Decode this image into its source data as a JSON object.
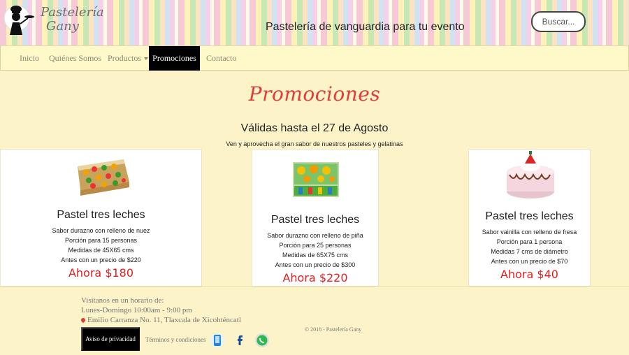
{
  "header": {
    "logo_line1": "Pastelería",
    "logo_line2": "Gany",
    "tagline": "Pastelería de vanguardia para tu evento",
    "search_label": "Buscar..."
  },
  "nav": {
    "items": [
      {
        "label": "Inicio"
      },
      {
        "label": "Quiénes Somos"
      },
      {
        "label": "Productos"
      },
      {
        "label": "Promociones"
      },
      {
        "label": "Contacto"
      }
    ],
    "active": "Promociones"
  },
  "main": {
    "title": "Promociones",
    "subtitle": "Válidas hasta el 27 de Agosto",
    "note": "Ven y aprovecha el gran sabor de nuestros pasteles y gelatinas"
  },
  "cards": [
    {
      "title": "Pastel tres leches",
      "lines": [
        "Sabor durazno con relleno de nuez",
        "Porción para 15 personas",
        "Medidas de 45X65 cms",
        "Antes con un precio de $220"
      ],
      "price": "Ahora $180"
    },
    {
      "title": "Pastel tres leches",
      "lines": [
        "Sabor durazno con relleno de piña",
        "Porción para 25 personas",
        "Medidas de 65X75 cms",
        "Antes con un precio de $300"
      ],
      "price": "Ahora $220"
    },
    {
      "title": "Pastel tres leches",
      "lines": [
        "Sabor vainilla con relleno de fresa",
        "Porción para 1 persona",
        "Medidas 7 cms de diámetro",
        "Antes con un precio de $70"
      ],
      "price": "Ahora $40"
    }
  ],
  "footer": {
    "hours_title": "Visitanos en un horario de:",
    "hours": "Lunes-Domingo 10:00am - 9:00 pm",
    "address": "Emilio Carranza No. 11, Tlaxcala de Xicohténcatl",
    "privacy_label": "Aviso de privacidad",
    "terms_label": "Términos y condiciones",
    "copyright": "© 2018 - Pastelería Gany"
  },
  "colors": {
    "page_bg": "#fdf3c8",
    "title_red": "#e13b3b",
    "price_red": "#e02020",
    "nav_active": "#000000"
  },
  "icons": [
    "chef-logo-icon",
    "phone-icon",
    "facebook-icon",
    "whatsapp-icon",
    "location-pin-icon"
  ]
}
